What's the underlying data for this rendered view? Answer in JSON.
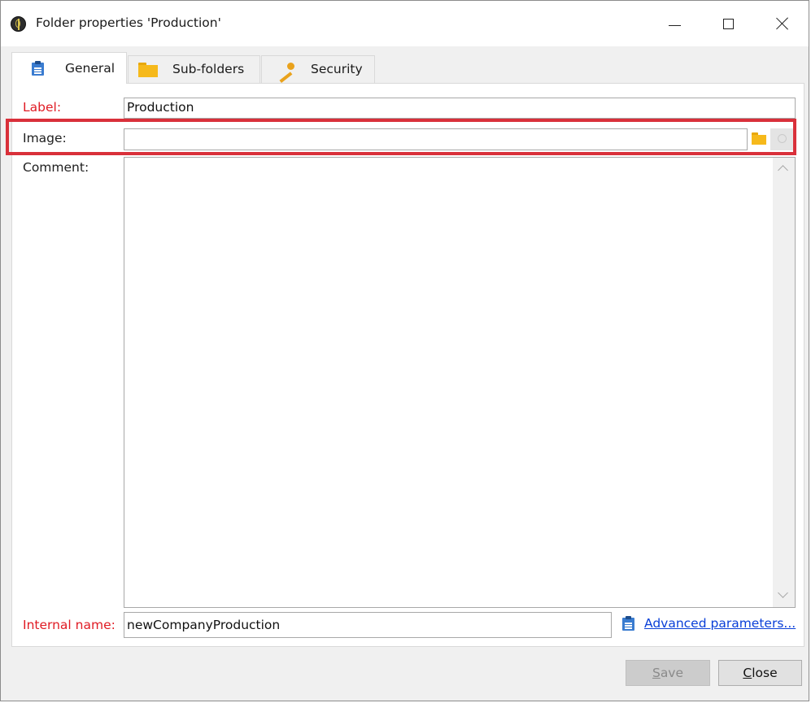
{
  "window": {
    "title": "Folder properties 'Production'",
    "icon": "app-logo-icon",
    "controls": [
      "minimize",
      "maximize",
      "close"
    ]
  },
  "tabs": [
    {
      "label": "General",
      "icon": "clipboard-icon",
      "active": true
    },
    {
      "label": "Sub-folders",
      "icon": "folder-icon",
      "active": false
    },
    {
      "label": "Security",
      "icon": "key-icon",
      "active": false
    }
  ],
  "form": {
    "label": {
      "caption": "Label:",
      "value": "Production",
      "required": true
    },
    "image": {
      "caption": "Image:",
      "value": ""
    },
    "comment": {
      "caption": "Comment:",
      "value": ""
    },
    "internal_name": {
      "caption": "Internal name:",
      "value": "newCompanyProduction",
      "required": true
    },
    "advanced_link": "Advanced parameters..."
  },
  "buttons": {
    "save": {
      "first": "S",
      "rest": "ave",
      "enabled": false
    },
    "close": {
      "first": "C",
      "rest": "lose",
      "enabled": true
    }
  },
  "colors": {
    "required_label": "#e01b24",
    "link": "#0b40d8",
    "highlight": "#d9303a",
    "folder": "#f6b91b",
    "clipboard": "#3a7cd0"
  }
}
